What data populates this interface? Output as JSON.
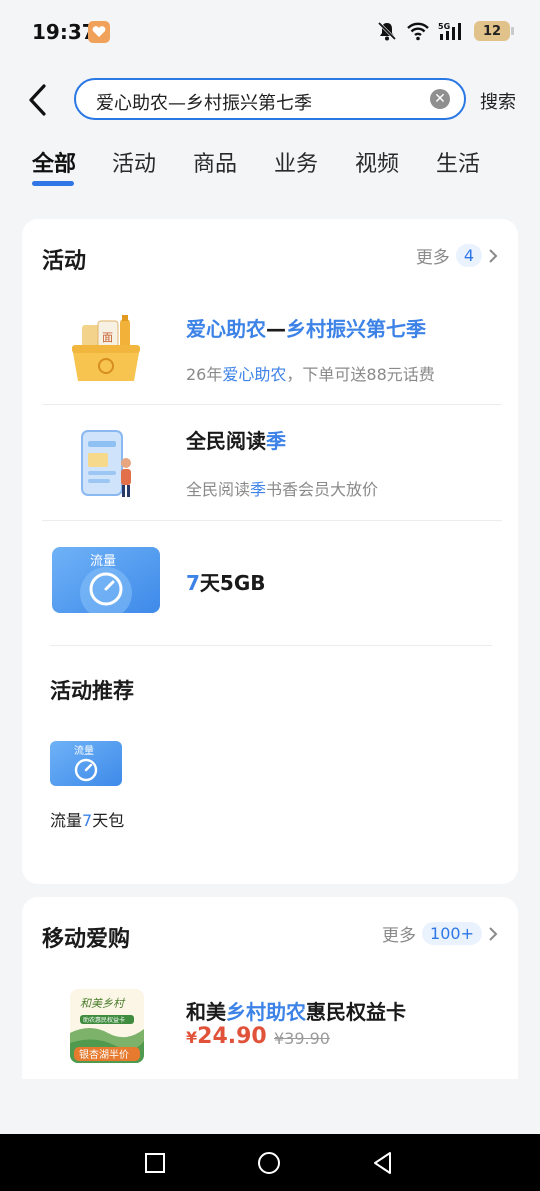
{
  "status_bar": {
    "time": "19:37",
    "battery": "12",
    "network": "5G"
  },
  "search": {
    "query": "爱心助农—乡村振兴第七季",
    "button_label": "搜索"
  },
  "tabs": [
    {
      "label": "全部",
      "active": true
    },
    {
      "label": "活动",
      "active": false
    },
    {
      "label": "商品",
      "active": false
    },
    {
      "label": "业务",
      "active": false
    },
    {
      "label": "视频",
      "active": false
    },
    {
      "label": "生活",
      "active": false
    }
  ],
  "activity_section": {
    "title": "活动",
    "more_label": "更多",
    "more_count": "4",
    "items": [
      {
        "title_hl": "爱心助农",
        "title_mid": "—",
        "title_hl2": "乡村振兴第七季",
        "desc_pre": "26年",
        "desc_hl": "爱心助农",
        "desc_post": "，下单可送88元话费"
      },
      {
        "title_pre": "全民阅读",
        "title_hl": "季",
        "desc_pre": "全民阅读",
        "desc_hl": "季",
        "desc_post": "书香会员大放价"
      },
      {
        "thumb_text": "流量",
        "title_hl": "7",
        "title_post": "天5GB"
      }
    ],
    "recommend": {
      "title": "活动推荐",
      "thumb_text": "流量",
      "label_pre": "流量",
      "label_hl": "7",
      "label_post": "天包"
    }
  },
  "shop_section": {
    "title": "移动爱购",
    "more_label": "更多",
    "more_count": "100+",
    "product": {
      "title_pre": "和美",
      "title_hl": "乡村助农",
      "title_post": "惠民权益卡",
      "price_symbol": "¥",
      "price": "24.90",
      "old_price": "¥39.90",
      "thumb_caption": "和美乡村",
      "thumb_sub": "助农惠民权益卡",
      "thumb_bottom": "银杏湖半价"
    }
  },
  "colors": {
    "accent": "#2f77e6",
    "highlight_text": "#3d83e7",
    "price": "#e0533a",
    "background": "#f4f5f7"
  }
}
